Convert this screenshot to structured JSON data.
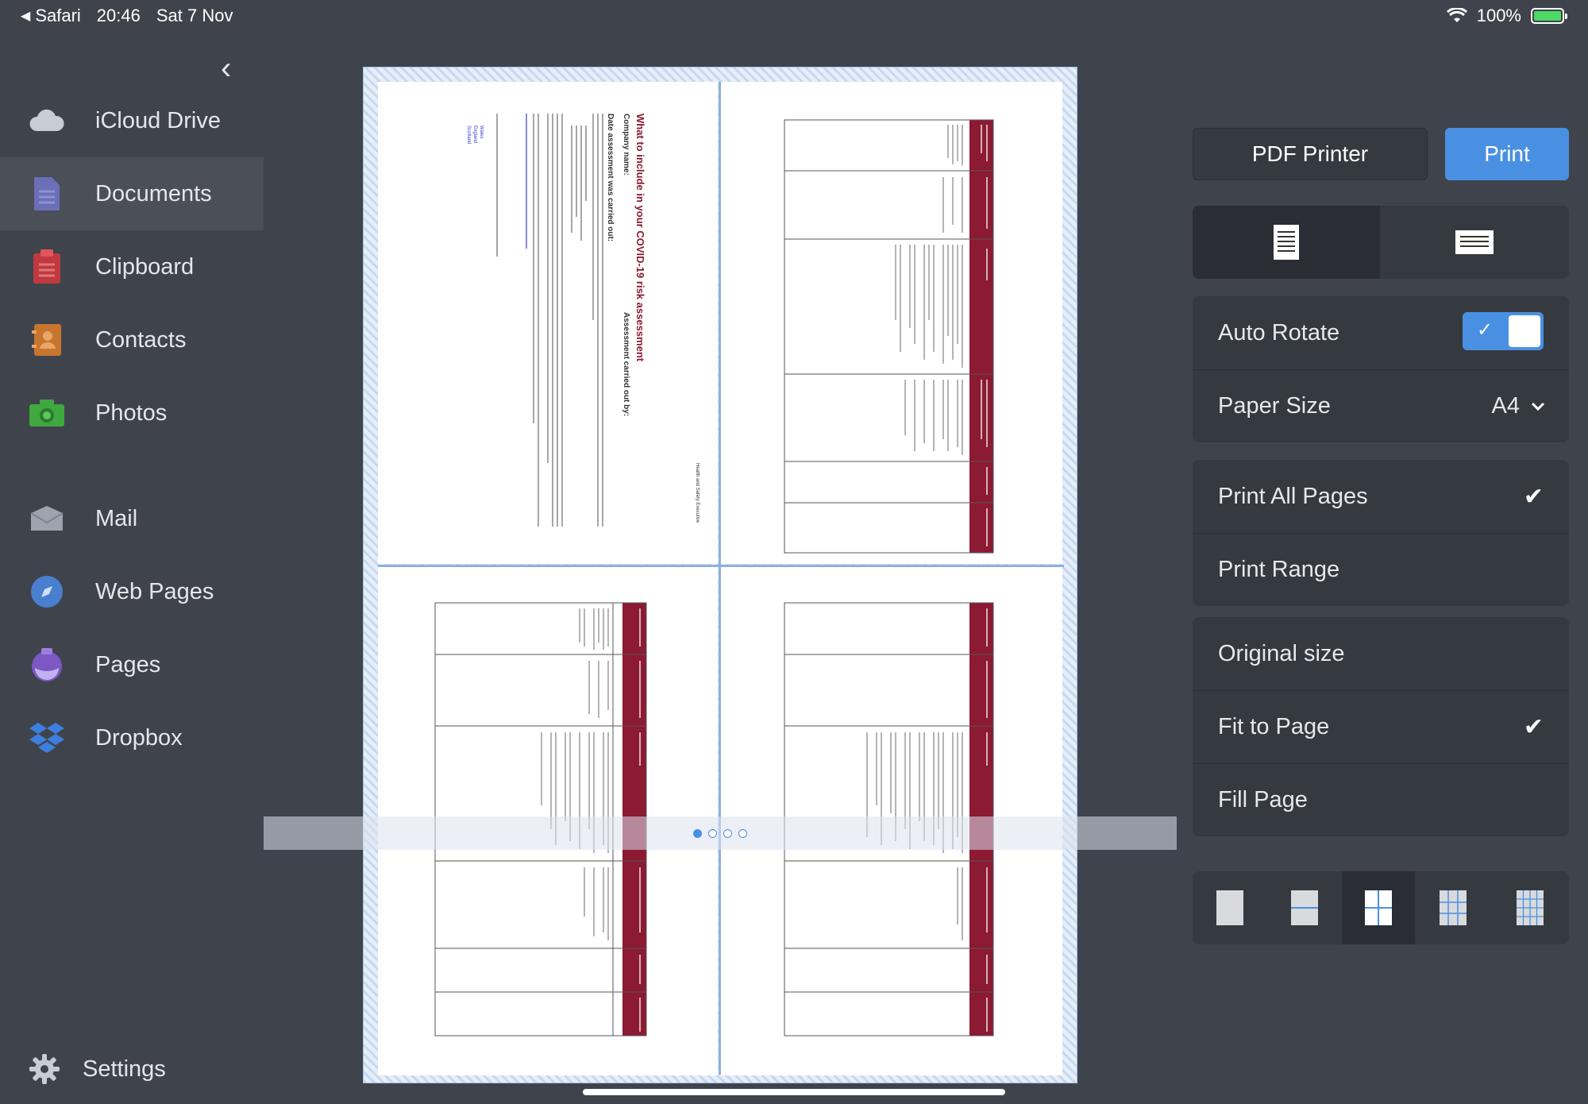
{
  "status_bar": {
    "app": "Safari",
    "time": "20:46",
    "date": "Sat 7 Nov",
    "battery": "100%"
  },
  "sidebar": {
    "items": [
      {
        "label": "iCloud Drive",
        "icon": "cloud-icon"
      },
      {
        "label": "Documents",
        "icon": "document-icon"
      },
      {
        "label": "Clipboard",
        "icon": "clipboard-icon"
      },
      {
        "label": "Contacts",
        "icon": "contacts-icon"
      },
      {
        "label": "Photos",
        "icon": "camera-icon"
      },
      {
        "label": "Mail",
        "icon": "mail-icon"
      },
      {
        "label": "Web Pages",
        "icon": "compass-icon"
      },
      {
        "label": "Pages",
        "icon": "pages-icon"
      },
      {
        "label": "Dropbox",
        "icon": "dropbox-icon"
      }
    ],
    "active": "Documents",
    "settings_label": "Settings"
  },
  "preview": {
    "page1": {
      "title": "What to include in your COVID-19 risk assessment",
      "company": "Company name:",
      "assessed_by": "Assessment carried out by:",
      "date": "Date assessment was carried out:",
      "header": "Health and Safety Executive",
      "links": [
        "Wales",
        "England",
        "Scotland"
      ]
    },
    "table_headers": [
      "What are the hazards?",
      "Who might be harmed and how?",
      "Controls",
      "What further action do you need to consider to control the risks?",
      "Who needs to carry out the action?",
      "When is the action needed by?"
    ],
    "page_count": 4,
    "current_page": 1
  },
  "print_panel": {
    "printer": "PDF Printer",
    "print_label": "Print",
    "auto_rotate_label": "Auto Rotate",
    "auto_rotate": true,
    "paper_size_label": "Paper Size",
    "paper_size": "A4",
    "range_options": [
      "Print All Pages",
      "Print Range"
    ],
    "range_selected": "Print All Pages",
    "scale_options": [
      "Original size",
      "Fit to Page",
      "Fill Page"
    ],
    "scale_selected": "Fit to Page",
    "accent_color": "#4a90e2",
    "brand_red": "#8b1a32"
  }
}
